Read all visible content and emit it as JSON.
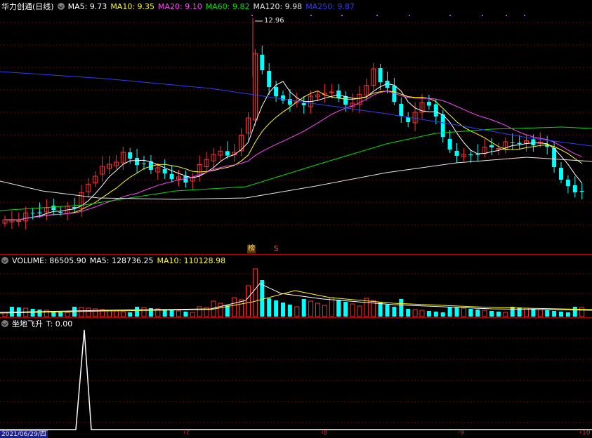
{
  "price_panel": {
    "title": "华力创通(日线)",
    "ma": [
      {
        "label": "MA5: 9.73",
        "color": "#ffffff"
      },
      {
        "label": "MA10: 9.35",
        "color": "#ffff00"
      },
      {
        "label": "MA20: 9.10",
        "color": "#ff44ff"
      },
      {
        "label": "MA60: 9.82",
        "color": "#00e000"
      },
      {
        "label": "MA120: 9.98",
        "color": "#e6e6e6"
      },
      {
        "label": "MA250: 9.87",
        "color": "#2f3cff"
      }
    ],
    "peak_label": "12.96",
    "badge_bang": "榜",
    "badge_s": "S"
  },
  "volume_panel": {
    "title": "VOLUME: 86505.90",
    "ma": [
      {
        "label": "MA5: 128736.25",
        "color": "#ffffff"
      },
      {
        "label": "MA10: 110128.98",
        "color": "#ffff00"
      }
    ]
  },
  "indicator_panel": {
    "title": "坐地飞升",
    "value": "T: 0.00"
  },
  "axis": {
    "date": "2021/06/29/四",
    "ticks": [
      "7",
      "8",
      "9",
      "10"
    ]
  },
  "colors": {
    "up": "#ff3030",
    "down": "#00ffff",
    "grid": "#7a0000",
    "separator": "#b00000"
  }
}
